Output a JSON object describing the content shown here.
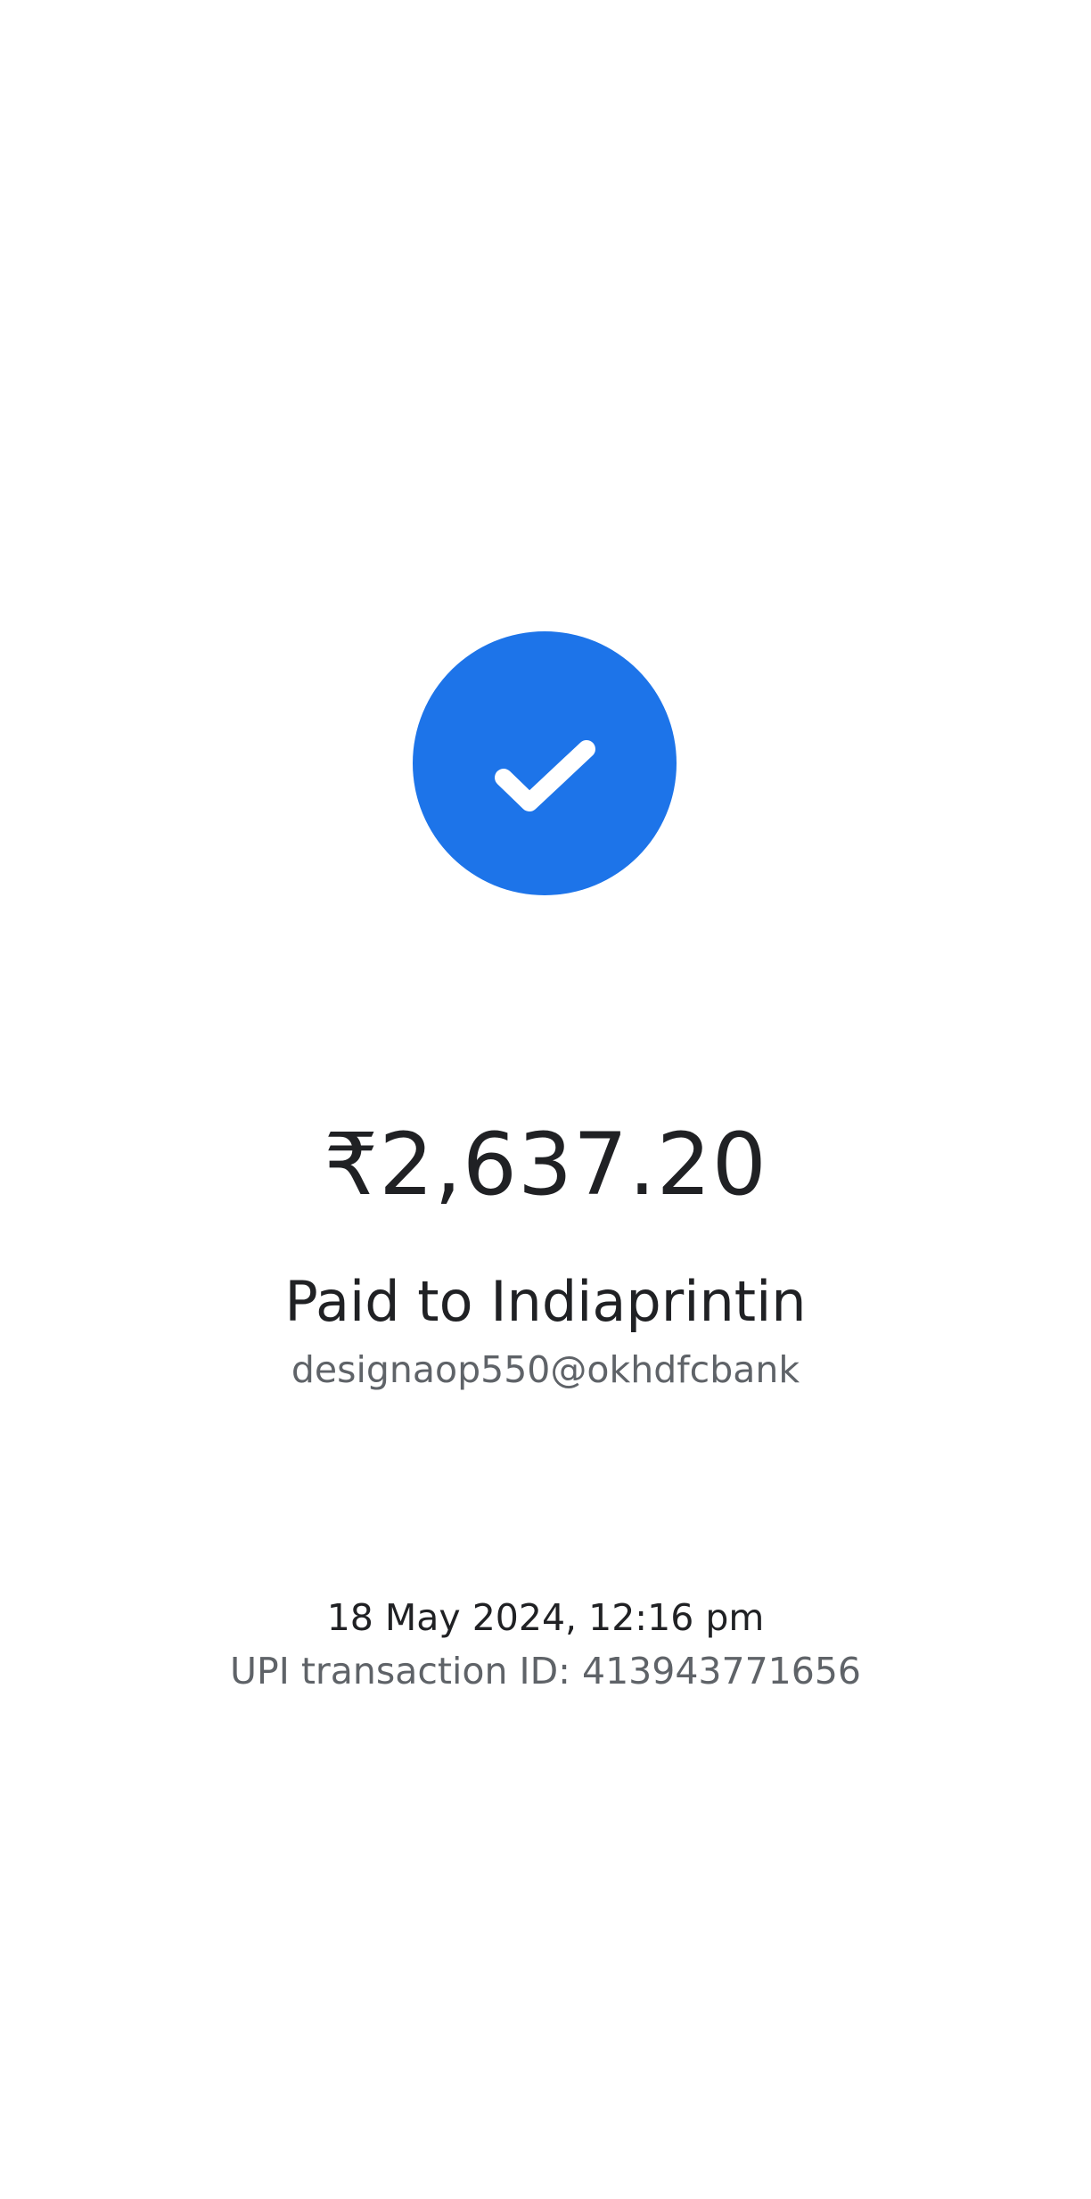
{
  "status": {
    "icon": "check-icon",
    "color": "#1d74e9"
  },
  "payment": {
    "amount": "₹2,637.20",
    "payee_line": "Paid to Indiaprintin",
    "payee_upi": "designaop550@okhdfcbank",
    "datetime": "18 May 2024, 12:16 pm",
    "transaction_line": "UPI transaction ID: 413943771656"
  }
}
